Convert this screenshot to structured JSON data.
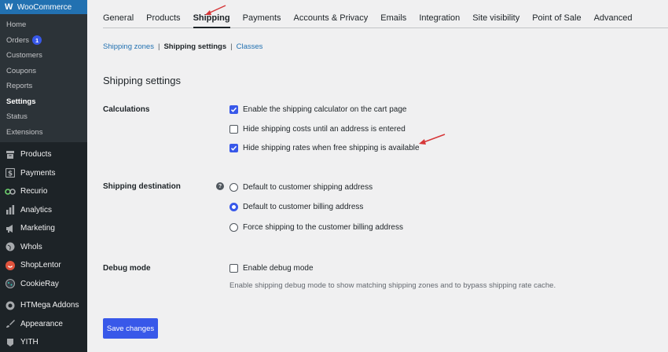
{
  "sidebar": {
    "header": {
      "logo": "W",
      "label": "WooCommerce"
    },
    "submenu": [
      {
        "label": "Home"
      },
      {
        "label": "Orders",
        "badge": "1"
      },
      {
        "label": "Customers"
      },
      {
        "label": "Coupons"
      },
      {
        "label": "Reports"
      },
      {
        "label": "Settings",
        "active": true
      },
      {
        "label": "Status"
      },
      {
        "label": "Extensions"
      }
    ],
    "menu": [
      {
        "label": "Products",
        "icon": "archive-icon"
      },
      {
        "label": "Payments",
        "icon": "dollar-icon"
      },
      {
        "label": "Recurio",
        "icon": "infinity-icon"
      },
      {
        "label": "Analytics",
        "icon": "bar-chart-icon"
      },
      {
        "label": "Marketing",
        "icon": "megaphone-icon"
      },
      {
        "label": "Whols",
        "icon": "globe-icon"
      },
      {
        "label": "ShopLentor",
        "icon": "shoplentor-icon"
      },
      {
        "label": "CookieRay",
        "icon": "cookie-icon"
      },
      {
        "label": "HTMega Addons",
        "icon": "htmega-icon"
      },
      {
        "label": "Appearance",
        "icon": "paintbrush-icon"
      },
      {
        "label": "YITH",
        "icon": "yith-icon"
      }
    ]
  },
  "tabs": [
    {
      "label": "General"
    },
    {
      "label": "Products"
    },
    {
      "label": "Shipping",
      "active": true
    },
    {
      "label": "Payments"
    },
    {
      "label": "Accounts & Privacy"
    },
    {
      "label": "Emails"
    },
    {
      "label": "Integration"
    },
    {
      "label": "Site visibility"
    },
    {
      "label": "Point of Sale"
    },
    {
      "label": "Advanced"
    }
  ],
  "subnav": {
    "zones": "Shipping zones",
    "settings": "Shipping settings",
    "classes": "Classes",
    "sep": "|"
  },
  "heading": "Shipping settings",
  "calculations": {
    "label": "Calculations",
    "options": [
      {
        "label": "Enable the shipping calculator on the cart page",
        "checked": true
      },
      {
        "label": "Hide shipping costs until an address is entered",
        "checked": false
      },
      {
        "label": "Hide shipping rates when free shipping is available",
        "checked": true
      }
    ]
  },
  "destination": {
    "label": "Shipping destination",
    "help": "?",
    "options": [
      {
        "label": "Default to customer shipping address",
        "checked": false
      },
      {
        "label": "Default to customer billing address",
        "checked": true
      },
      {
        "label": "Force shipping to the customer billing address",
        "checked": false
      }
    ]
  },
  "debug": {
    "label": "Debug mode",
    "option": {
      "label": "Enable debug mode",
      "checked": false
    },
    "description": "Enable shipping debug mode to show matching shipping zones and to bypass shipping rate cache."
  },
  "save_label": "Save changes",
  "colors": {
    "accent": "#3858e9",
    "sidebar_bg": "#1d2327",
    "submenu_bg": "#2c3338",
    "link": "#2271b1",
    "annotation_arrow": "#d63638"
  }
}
